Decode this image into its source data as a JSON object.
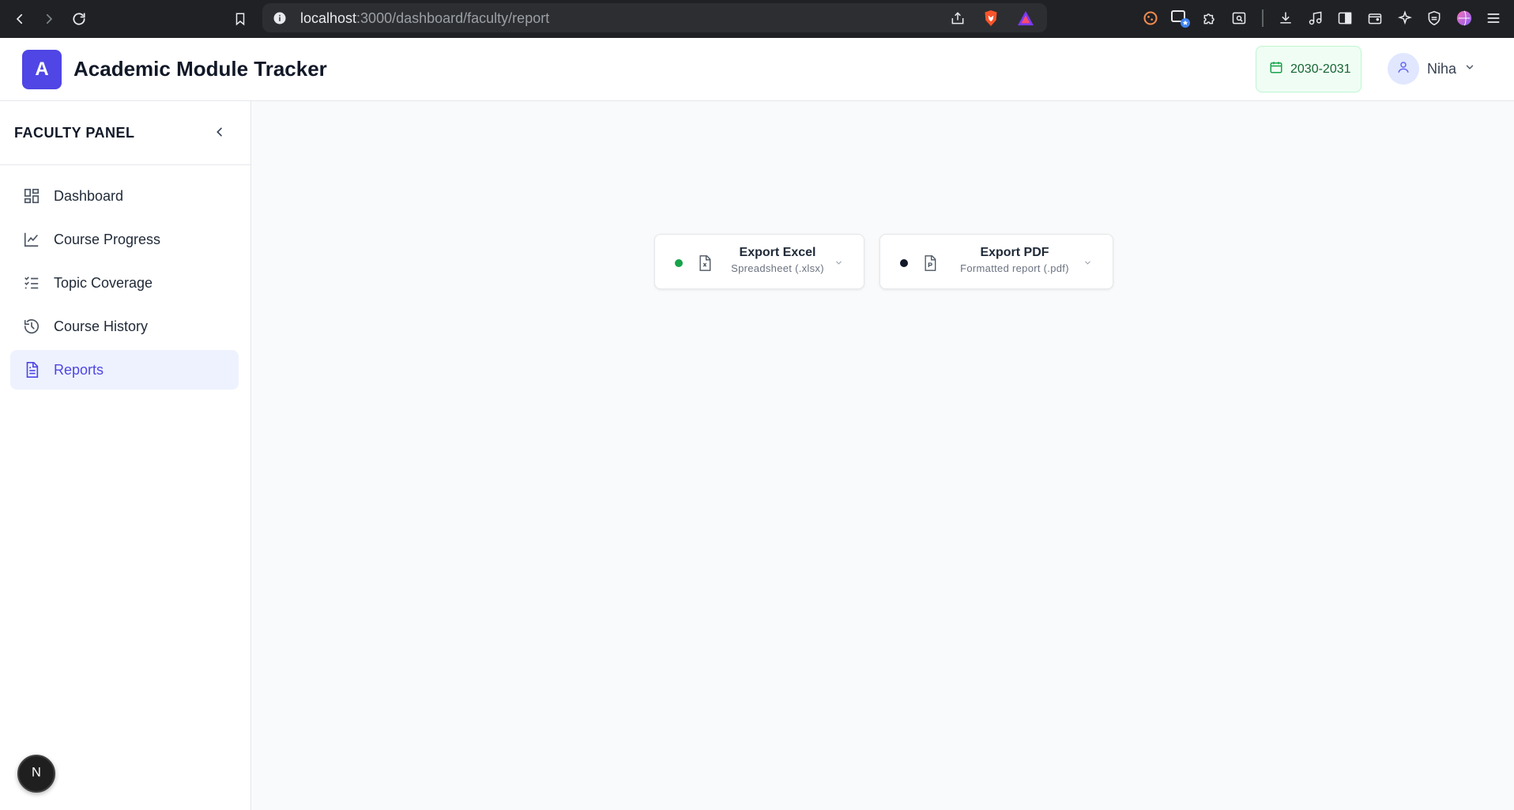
{
  "browser": {
    "url_host": "localhost",
    "url_path": ":3000/dashboard/faculty/report"
  },
  "header": {
    "logo_letter": "A",
    "title": "Academic Module Tracker",
    "academic_year": "2030-2031",
    "user_name": "Niha"
  },
  "sidebar": {
    "panel_title": "FACULTY PANEL",
    "items": [
      {
        "label": "Dashboard",
        "icon": "dashboard-icon"
      },
      {
        "label": "Course Progress",
        "icon": "line-chart-icon"
      },
      {
        "label": "Topic Coverage",
        "icon": "checklist-icon"
      },
      {
        "label": "Course History",
        "icon": "history-icon"
      },
      {
        "label": "Reports",
        "icon": "document-icon",
        "active": true
      }
    ]
  },
  "exports": [
    {
      "title": "Export Excel",
      "subtitle": "Spreadsheet (.xlsx)",
      "dot_color": "#16a34a"
    },
    {
      "title": "Export PDF",
      "subtitle": "Formatted report (.pdf)",
      "dot_color": "#111827"
    }
  ],
  "colors": {
    "accent": "#4f46e5",
    "active_bg": "#eef2ff",
    "year_badge_bg": "#f0fdf4",
    "year_badge_text": "#166534"
  },
  "dev_badge_letter": "N"
}
